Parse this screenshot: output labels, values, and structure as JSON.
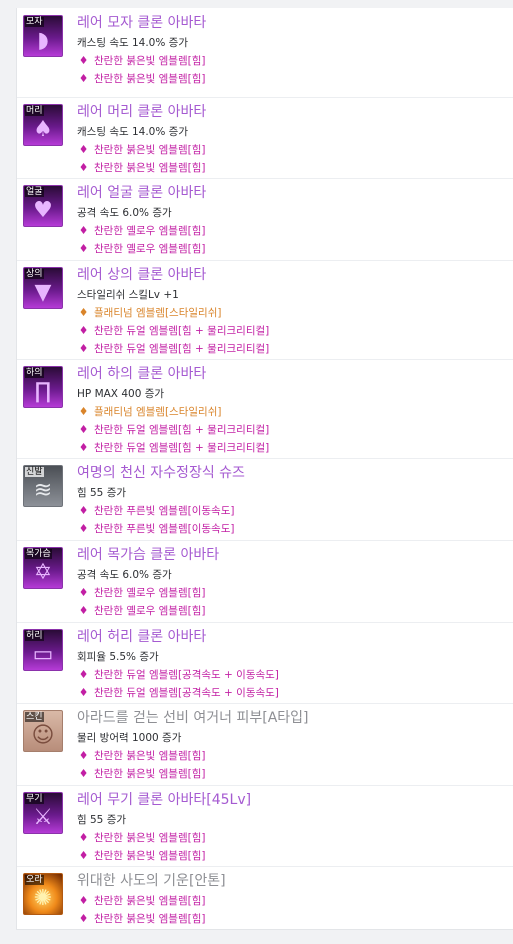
{
  "items": [
    {
      "slot": "모자",
      "title": "레어 모자 클론 아바타",
      "stat": "캐스팅 속도 14.0% 증가",
      "emblems": [
        "찬란한 붉은빛 엠블렘[힘]",
        "찬란한 붉은빛 엠블렘[힘]"
      ]
    },
    {
      "slot": "머리",
      "title": "레어 머리 클론 아바타",
      "stat": "캐스팅 속도 14.0% 증가",
      "emblems": [
        "찬란한 붉은빛 엠블렘[힘]",
        "찬란한 붉은빛 엠블렘[힘]"
      ]
    },
    {
      "slot": "얼굴",
      "title": "레어 얼굴 클론 아바타",
      "stat": "공격 속도 6.0% 증가",
      "emblems": [
        "찬란한 옐로우 엠블렘[힘]",
        "찬란한 옐로우 엠블렘[힘]"
      ]
    },
    {
      "slot": "상의",
      "title": "레어 상의 클론 아바타",
      "stat": "스타일리쉬 스킬Lv +1",
      "emblems": [
        "플래티넘 엠블렘[스타일리쉬]",
        "찬란한 듀얼 엠블렘[힘 + 물리크리티컬]",
        "찬란한 듀얼 엠블렘[힘 + 물리크리티컬]"
      ]
    },
    {
      "slot": "하의",
      "title": "레어 하의 클론 아바타",
      "stat": "HP MAX 400 증가",
      "emblems": [
        "플래티넘 엠블렘[스타일리쉬]",
        "찬란한 듀얼 엠블렘[힘 + 물리크리티컬]",
        "찬란한 듀얼 엠블렘[힘 + 물리크리티컬]"
      ]
    },
    {
      "slot": "신발",
      "title": "여명의 천신 자수정장식 슈즈",
      "stat": "힘 55 증가",
      "emblems": [
        "찬란한 푸른빛 엠블렘[이동속도]",
        "찬란한 푸른빛 엠블렘[이동속도]"
      ]
    },
    {
      "slot": "목가슴",
      "title": "레어 목가슴 클론 아바타",
      "stat": "공격 속도 6.0% 증가",
      "emblems": [
        "찬란한 옐로우 엠블렘[힘]",
        "찬란한 옐로우 엠블렘[힘]"
      ]
    },
    {
      "slot": "허리",
      "title": "레어 허리 클론 아바타",
      "stat": "회피율 5.5% 증가",
      "emblems": [
        "찬란한 듀얼 엠블렘[공격속도 + 이동속도]",
        "찬란한 듀얼 엠블렘[공격속도 + 이동속도]"
      ]
    },
    {
      "slot": "스킨",
      "title": "아라드를 걷는 선비 여거너 피부[A타입]",
      "stat": "물리 방어력 1000 증가",
      "emblems": [
        "찬란한 붉은빛 엠블렘[힘]",
        "찬란한 붉은빛 엠블렘[힘]"
      ]
    },
    {
      "slot": "무기",
      "title": "레어 무기 클론 아바타[45Lv]",
      "stat": "힘 55 증가",
      "emblems": [
        "찬란한 붉은빛 엠블렘[힘]",
        "찬란한 붉은빛 엠블렘[힘]"
      ]
    },
    {
      "slot": "오라",
      "title": "위대한 사도의 기운[안톤]",
      "stat": "",
      "emblems": [
        "찬란한 붉은빛 엠블렘[힘]",
        "찬란한 붉은빛 엠블렘[힘]"
      ]
    }
  ]
}
